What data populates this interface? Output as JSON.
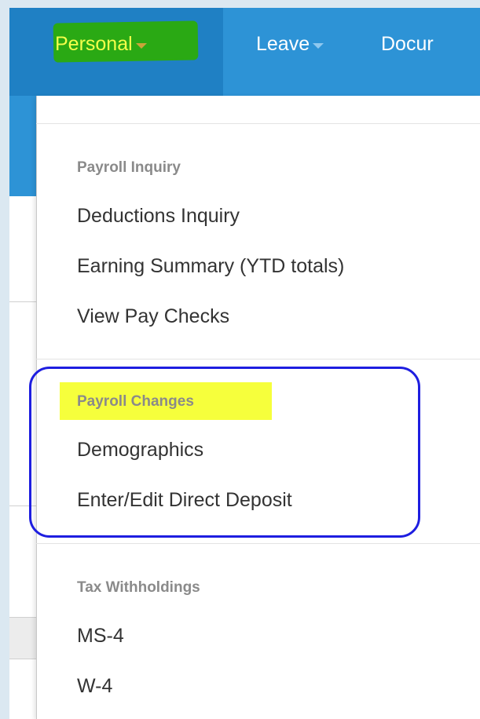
{
  "navbar": {
    "items": [
      {
        "label": "Personal",
        "active": true
      },
      {
        "label": "Leave",
        "active": false
      },
      {
        "label": "Docur",
        "active": false
      }
    ]
  },
  "dropdown": {
    "sections": [
      {
        "header": "Payroll Inquiry",
        "items": [
          "Deductions Inquiry",
          "Earning Summary (YTD totals)",
          "View Pay Checks"
        ]
      },
      {
        "header": "Payroll Changes",
        "items": [
          "Demographics",
          "Enter/Edit Direct Deposit"
        ]
      },
      {
        "header": "Tax Withholdings",
        "items": [
          "MS-4",
          "W-4"
        ]
      }
    ]
  },
  "colors": {
    "navbar": "#2d93d6",
    "navbar_active": "#1f80c4",
    "green_highlight": "#2aa914",
    "yellow_highlight": "#f6ff3c",
    "annotation_circle": "#1e1ee0"
  }
}
